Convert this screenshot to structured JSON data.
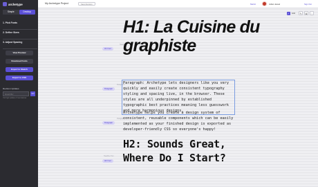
{
  "app": {
    "name": "archetype"
  },
  "sidebar": {
    "modes": [
      {
        "label": "Simple",
        "active": false
      },
      {
        "label": "Desktop",
        "active": true
      }
    ],
    "steps": [
      "1. Pick Fonts",
      "2. Define Sizes",
      "3. Adjust Spacing"
    ],
    "actions": [
      "View Preview",
      "Download Fonts",
      "Export to Sketch",
      "Export to CSS"
    ],
    "revision": {
      "label": "Revision Updates",
      "placeholder": "Email Me!",
      "button": "GO",
      "note": "You'll get updates of new features"
    }
  },
  "topbar": {
    "project": "My Archetype Project",
    "chip": "Save Revision",
    "metric": "Metric",
    "user": "Julian Jessel",
    "signout": "Sign Out"
  },
  "toolbar": {
    "grid_label": "Grid",
    "icons": [
      "pen-icon",
      "copy-icon",
      "more-icon"
    ]
  },
  "canvas": {
    "h1": {
      "tag": "H1: Font",
      "label": "Headline",
      "text": "H1: La Cuisine du graphiste"
    },
    "p1": {
      "tag": "Paragraph",
      "label": "Paragraph",
      "text": "Paragraph: Archetype lets designers like you very quickly and easily create consistent typography styling and spacing live, in the browser. These styles are all underpinned by established typographic best practices meaning less guesswork and more harmonious designs."
    },
    "p2": {
      "tag": "Paragraph",
      "label": "Paragraph",
      "text": "Archetype helps you create a design system of consistent, reusable components which can be easily implemented as your finished design is exported as developer-friendly CSS so everyone's happy!"
    },
    "h2": {
      "tag": "H2: Font",
      "label": "Headline Two",
      "text": "H2: Sounds Great, Where Do I Start?"
    }
  },
  "colors": {
    "accent": "#5b50d6",
    "sidebar": "#2b2b30"
  }
}
